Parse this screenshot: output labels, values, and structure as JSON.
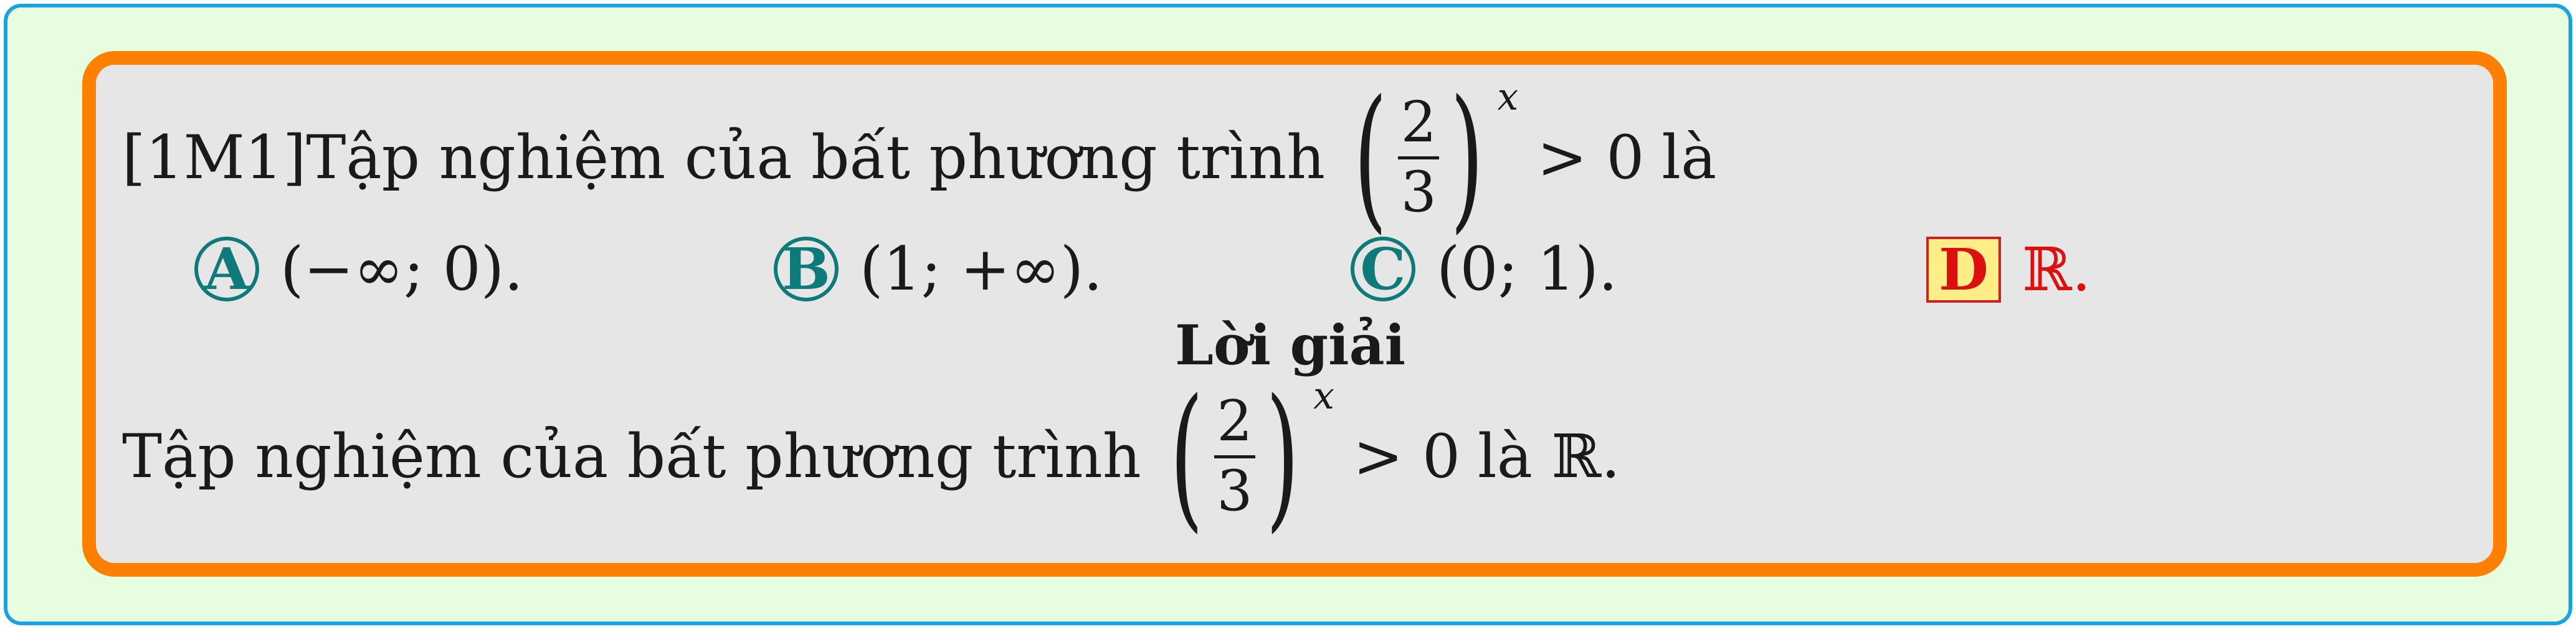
{
  "question": {
    "tag": "[1M1]",
    "text": "Tập nghiệm của bất phương trình",
    "fraction": {
      "numerator": "2",
      "denominator": "3"
    },
    "exponent": "x",
    "relation": "> 0",
    "tail": "là"
  },
  "options": [
    {
      "letter": "A",
      "value": "(−∞; 0).",
      "correct": false
    },
    {
      "letter": "B",
      "value": "(1; +∞).",
      "correct": false
    },
    {
      "letter": "C",
      "value": "(0; 1).",
      "correct": false
    },
    {
      "letter": "D",
      "value": "ℝ.",
      "correct": true
    }
  ],
  "solution": {
    "title": "Lời giải",
    "text": "Tập nghiệm của bất phương trình",
    "fraction": {
      "numerator": "2",
      "denominator": "3"
    },
    "exponent": "x",
    "relation": "> 0",
    "tail": "là ℝ."
  },
  "colors": {
    "outer_border": "#1aa3e0",
    "outer_bg": "#e6fde0",
    "card_border": "#ff8000",
    "card_bg": "#e6e6e6",
    "option_circle": "#0f7a7a",
    "correct_text": "#dd1010",
    "correct_box_bg": "#ffee88"
  }
}
